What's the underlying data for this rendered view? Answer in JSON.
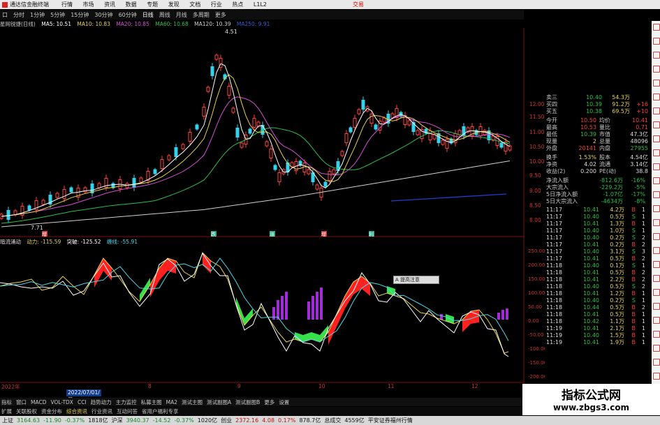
{
  "app": {
    "title": "通达信金融终端",
    "menu": [
      "行情",
      "市场",
      "资讯",
      "数据",
      "专题",
      "发现",
      "文档",
      "行业",
      "热点",
      "L1L2"
    ],
    "right_label": "交易"
  },
  "toolbar": {
    "items": [
      "口",
      "分时",
      "1分钟",
      "5分钟",
      "15分钟",
      "30分钟",
      "60分钟",
      "日线",
      "周线",
      "月线",
      "多周期",
      "更多"
    ],
    "active": "日线"
  },
  "main_indicators": {
    "stock_label": "星网锐捷(日线)",
    "items": [
      {
        "label": "MA5: 10.51",
        "color": "#ffffff"
      },
      {
        "label": "MA10: 10.83",
        "color": "#e8d24a"
      },
      {
        "label": "MA20: 10.85",
        "color": "#d64fd6"
      },
      {
        "label": "MA60: 10.68",
        "color": "#27c24c"
      },
      {
        "label": "MA120: 10.39",
        "color": "#cfcfcf"
      },
      {
        "label": "MA250: 9.91",
        "color": "#3a5bd8"
      }
    ],
    "high_label": "4.51",
    "low_label": "7.71"
  },
  "event_markers": [
    "增",
    "跌",
    "涨",
    "增",
    "利"
  ],
  "price_axis": [
    "12.00",
    "11.50",
    "11.00",
    "10.50",
    "10.00",
    "9.50",
    "9.00",
    "8.50",
    "8.00"
  ],
  "sub_indicator": {
    "name": "暗流涌动",
    "items": [
      {
        "label": "动力: -115.59",
        "color": "#e8d24a"
      },
      {
        "label": "突破: -125.52",
        "color": "#ffffff"
      },
      {
        "label": "缠线: -55.91",
        "color": "#4fd6e6"
      }
    ],
    "axis": [
      "250.00",
      "200.00",
      "150.00",
      "100.00",
      "50.00",
      "0.00",
      "-50.00",
      "-100.00",
      "-150.00",
      "-200.00"
    ]
  },
  "tooltip": "A 提高注意 ",
  "time_axis": [
    "2022年",
    "8",
    "9",
    "10",
    "11",
    "12"
  ],
  "date_box": "2022/07/01/五",
  "tabs": [
    "指标",
    "窗口",
    "MACD",
    "VOL-TDX",
    "CCI",
    "趋势动力",
    "主力监控",
    "私募主图",
    "MA2",
    "测试主图",
    "测试副图A",
    "测试副图B",
    "更多",
    "设置"
  ],
  "links": [
    "扩展",
    "关联股权",
    "资金分布",
    "综合资讯",
    "行业资讯",
    "互动问答",
    "省用户福利专享"
  ],
  "quote_panel": {
    "order_book": [
      {
        "label": "卖三",
        "price": "10.40",
        "vol": "54.3万",
        "chg": ""
      },
      {
        "label": "买四",
        "price": "10.39",
        "vol": "91.2万",
        "chg": "+16"
      },
      {
        "label": "买五",
        "price": "10.38",
        "vol": "69.5万",
        "chg": "+10"
      }
    ],
    "stats": [
      {
        "k1": "今开",
        "v1": "10.50",
        "k2": "均价",
        "v2": "10.41"
      },
      {
        "k1": "最高",
        "v1": "10.53",
        "k2": "量比",
        "v2": "0.71"
      },
      {
        "k1": "最低",
        "v1": "10.39",
        "k2": "市值",
        "v2": "47.3亿"
      },
      {
        "k1": "现量",
        "v1": "2",
        "k2": "总量",
        "v2": "48096"
      },
      {
        "k1": "外盘",
        "v1": "20141",
        "k2": "内盘",
        "v2": "27955"
      }
    ],
    "stats2": [
      {
        "k1": "换手",
        "v1": "1.53%",
        "k2": "股本",
        "v2": "4.54亿"
      },
      {
        "k1": "净资",
        "v1": "4.02",
        "k2": "流通",
        "v2": "3.14亿"
      },
      {
        "k1": "收益(2)",
        "v1": "0.200",
        "k2": "PE(动)",
        "v2": "38.8"
      }
    ],
    "flows": [
      {
        "label": "净流入额",
        "value": "-812.6万",
        "pct": "-16%"
      },
      {
        "label": "大宗流入",
        "value": "-229.2万",
        "pct": "-5%"
      },
      {
        "label": "5日净流入额",
        "value": "-1.07亿",
        "pct": "-17%"
      },
      {
        "label": "5日大宗流入",
        "value": "-4634万",
        "pct": "-8%"
      }
    ],
    "ticks": [
      {
        "t": "11:17",
        "p": "10.41",
        "v": "4.2万",
        "s": "B",
        "n": "1"
      },
      {
        "t": "11:17",
        "p": "10.40",
        "v": "0.5万",
        "s": "S",
        "n": "1"
      },
      {
        "t": "11:17",
        "p": "10.41",
        "v": "1.3万",
        "s": "B",
        "n": "1"
      },
      {
        "t": "11:17",
        "p": "10.40",
        "v": "1.0万",
        "s": "S",
        "n": "1"
      },
      {
        "t": "11:17",
        "p": "10.40",
        "v": "0.2万",
        "s": "S",
        "n": "2"
      },
      {
        "t": "11:17",
        "p": "10.41",
        "v": "0.2万",
        "s": "B",
        "n": "2"
      },
      {
        "t": "11:17",
        "p": "10.40",
        "v": "3.1万",
        "s": "S",
        "n": "3"
      },
      {
        "t": "11:17",
        "p": "10.41",
        "v": "0.5万",
        "s": "B",
        "n": "2"
      },
      {
        "t": "11:18",
        "p": "10.40",
        "v": "0.1万",
        "s": "S",
        "n": "1"
      },
      {
        "t": "11:18",
        "p": "10.41",
        "v": "0.5万",
        "s": "B",
        "n": "2"
      },
      {
        "t": "11:18",
        "p": "10.41",
        "v": "2.2万",
        "s": "B",
        "n": "2"
      },
      {
        "t": "11:18",
        "p": "10.40",
        "v": "0.5万",
        "s": "S",
        "n": "2"
      },
      {
        "t": "11:18",
        "p": "10.41",
        "v": "1.2万",
        "s": "B",
        "n": "1"
      },
      {
        "t": "11:18",
        "p": "10.40",
        "v": "0.2万",
        "s": "S",
        "n": "1"
      },
      {
        "t": "11:18",
        "p": "10.44",
        "v": "0.5万",
        "s": "B",
        "n": "2"
      },
      {
        "t": "11:18",
        "p": "10.41",
        "v": "0.5万",
        "s": "B",
        "n": "1"
      },
      {
        "t": "11:18",
        "p": "10.42",
        "v": "1.1万",
        "s": "B",
        "n": "1"
      },
      {
        "t": "11:19",
        "p": "10.41",
        "v": "2.1万",
        "s": "B",
        "n": "1"
      },
      {
        "t": "11:19",
        "p": "10.40",
        "v": "1.5万",
        "s": "B",
        "n": "1"
      },
      {
        "t": "11:19",
        "p": "10.41",
        "v": "1.9万",
        "s": "B",
        "n": "1"
      }
    ]
  },
  "status_bar": [
    {
      "label": "上证",
      "value": "3164.63",
      "chg": "-11.90",
      "pct": "-0.37%",
      "amt": "1818亿"
    },
    {
      "label": "沪深",
      "value": "3940.37",
      "chg": "-14.52",
      "pct": "-0.37%",
      "amt": "1020亿"
    },
    {
      "label": "创业",
      "value": "2372.16",
      "chg": "4.08",
      "pct": "0.17%",
      "amt": "878.7亿"
    },
    {
      "label": "总成交",
      "value": "4559亿",
      "chg": "",
      "pct": "",
      "amt": ""
    }
  ],
  "status_tail": "平安证券福州行情",
  "watermark": {
    "title": "指标公式网",
    "url": "www.zbgs3.com"
  }
}
